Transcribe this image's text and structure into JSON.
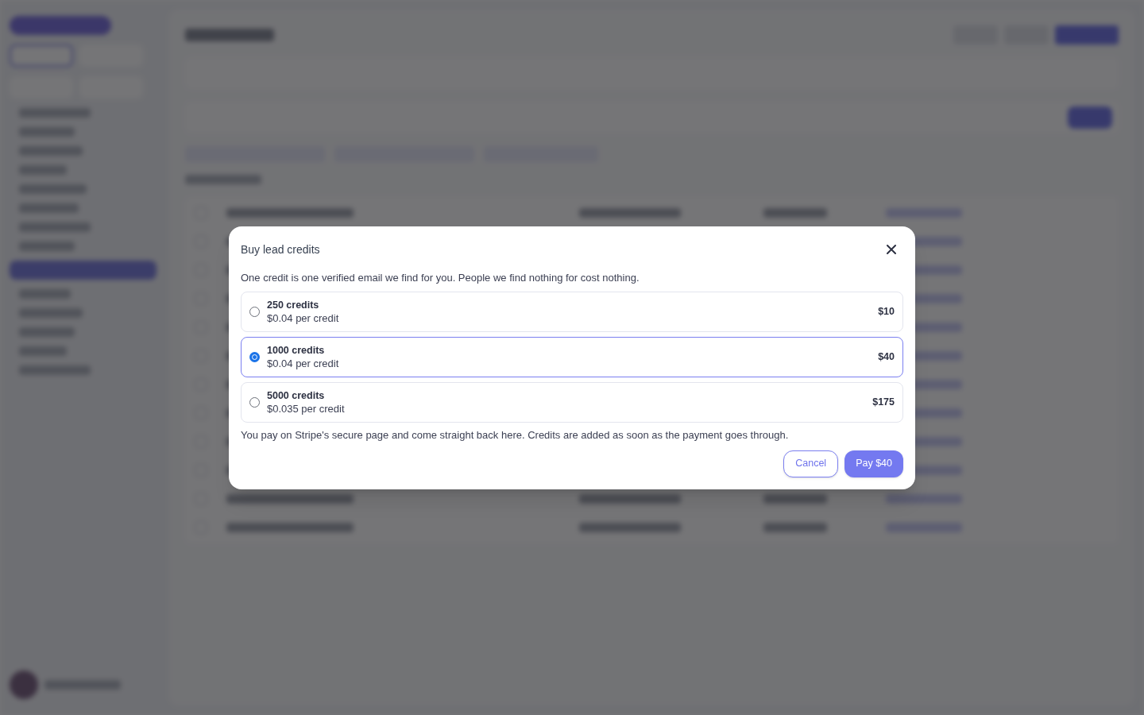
{
  "dialog": {
    "title": "Buy lead credits",
    "description": "One credit is one verified email we find for you. People we find nothing for cost nothing.",
    "options": [
      {
        "credits": "250 credits",
        "per_credit": "$0.04 per credit",
        "price": "$10",
        "selected": false
      },
      {
        "credits": "1000 credits",
        "per_credit": "$0.04 per credit",
        "price": "$40",
        "selected": true
      },
      {
        "credits": "5000 credits",
        "per_credit": "$0.035 per credit",
        "price": "$175",
        "selected": false
      }
    ],
    "note": "You pay on Stripe's secure page and come straight back here. Credits are added as soon as the payment goes through.",
    "buttons": [
      {
        "label": "Cancel",
        "kind": "secondary"
      },
      {
        "label": "Pay $40",
        "kind": "primary"
      }
    ]
  }
}
